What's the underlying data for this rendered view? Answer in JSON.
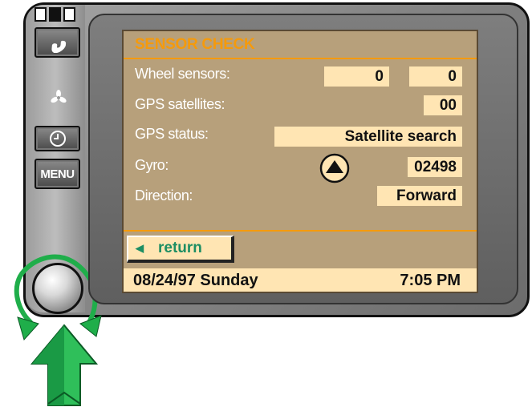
{
  "device": {
    "buttons": {
      "phone_icon": "phone-icon",
      "fan_icon": "fan-icon",
      "clock_icon": "clock-icon",
      "menu_label": "MENU"
    },
    "knob_icon": "rotary-knob",
    "arrows": [
      "rotate-arrows",
      "push-arrow"
    ]
  },
  "screen": {
    "title": "SENSOR CHECK",
    "rows": [
      {
        "label": "Wheel sensors:",
        "values": [
          "0",
          "0"
        ]
      },
      {
        "label": "GPS satellites:",
        "value": "00"
      },
      {
        "label": "GPS status:",
        "value": "Satellite search"
      },
      {
        "label": "Gyro:",
        "value": "02498",
        "icon": "gyro-icon"
      },
      {
        "label": "Direction:",
        "value": "Forward"
      }
    ],
    "return_label": "return",
    "status": {
      "date": "08/24/97 Sunday",
      "time": "7:05 PM"
    }
  },
  "colors": {
    "screen_bg": "#b7a07b",
    "value_bg": "#ffe5b3",
    "title": "#f59a0c",
    "return_text": "#1d8e63",
    "arrow_green": "#1fae4a"
  }
}
